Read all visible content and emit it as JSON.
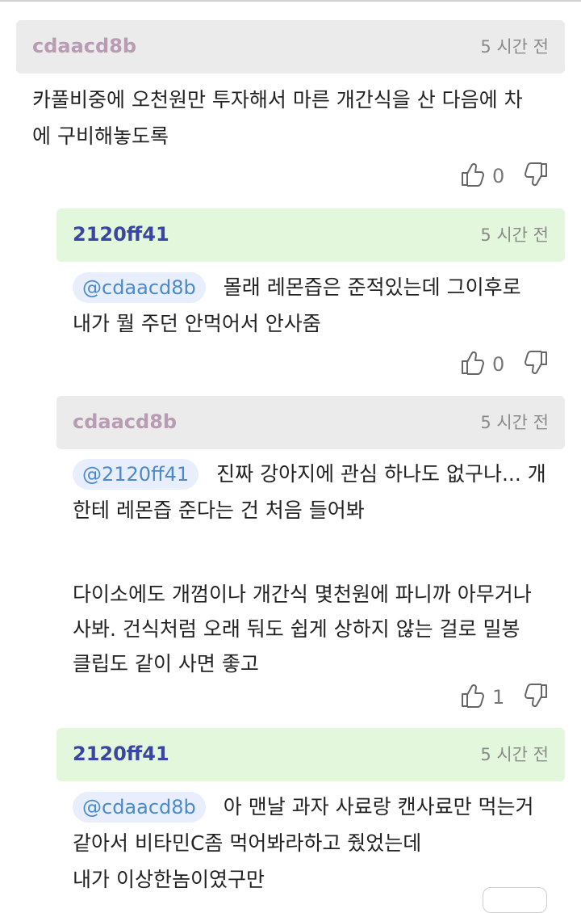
{
  "comments": [
    {
      "author": "cdaacd8b",
      "time": "5 시간 전",
      "lines": [
        "카풀비중에 오천원만 투자해서 마른 개간식을 산 다음에 차",
        "에 구비해놓도록"
      ],
      "likes": "0"
    },
    {
      "author": "2120ff41",
      "time": "5 시간 전",
      "mention": "@cdaacd8b",
      "line1": "몰래 레몬즙은 준적있는데 그이후로",
      "lines": [
        "내가 뭘 주던 안먹어서 안사줌"
      ],
      "likes": "0"
    },
    {
      "author": "cdaacd8b",
      "time": "5 시간 전",
      "mention": "@2120ff41",
      "line1": "진짜 강아지에 관심 하나도 없구나... 개",
      "lines": [
        "한테 레몬즙 준다는 건 처음 들어봐"
      ],
      "lines2": [
        "다이소에도 개껌이나 개간식 몇천원에 파니까 아무거나",
        "사봐. 건식처럼 오래 둬도 쉽게 상하지 않는 걸로 밀봉",
        "클립도 같이 사면 좋고"
      ],
      "likes": "1"
    },
    {
      "author": "2120ff41",
      "time": "5 시간 전",
      "mention": "@cdaacd8b",
      "line1": "아 맨날 과자 사료랑 캔사료만 먹는거",
      "lines": [
        "같아서 비타민C좀 먹어봐라하고 줬었는데",
        "내가 이상한놈이였구만"
      ]
    }
  ],
  "icons": {
    "like": "thumbs-up-icon",
    "dislike": "thumbs-down-icon"
  },
  "colors": {
    "gray_header": "#ebebeb",
    "green_header": "#e3f7dc",
    "mention_text": "#4a8acb",
    "reply_author": "#3a46a6"
  }
}
